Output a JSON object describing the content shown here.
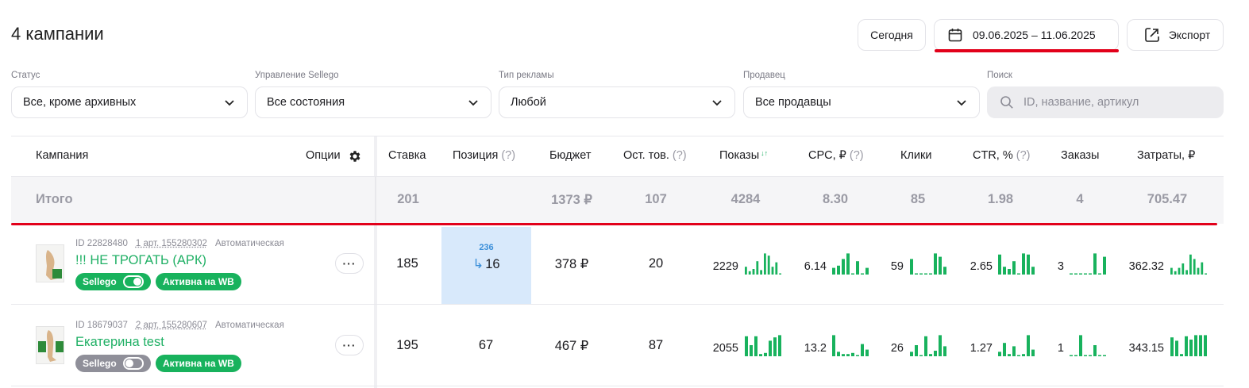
{
  "header": {
    "title": "4 кампании",
    "today_label": "Сегодня",
    "date_range": "09.06.2025 – 11.06.2025",
    "export_label": "Экспорт"
  },
  "filters": {
    "status": {
      "label": "Статус",
      "value": "Все, кроме архивных"
    },
    "management": {
      "label": "Управление Sellego",
      "value": "Все состояния"
    },
    "ad_type": {
      "label": "Тип рекламы",
      "value": "Любой"
    },
    "seller": {
      "label": "Продавец",
      "value": "Все продавцы"
    },
    "search": {
      "label": "Поиск",
      "placeholder": "ID, название, артикул"
    }
  },
  "table": {
    "headers": {
      "campaign": "Кампания",
      "options": "Опции",
      "bid": "Ставка",
      "position": "Позиция",
      "budget": "Бюджет",
      "stock": "Ост. тов.",
      "impressions": "Показы",
      "cpc": "CPC, ₽",
      "clicks": "Клики",
      "ctr": "CTR, %",
      "orders": "Заказы",
      "spend": "Затраты, ₽",
      "help": "(?)"
    },
    "total": {
      "label": "Итого",
      "bid": "201",
      "budget": "1373 ₽",
      "stock": "107",
      "impressions": "4284",
      "cpc": "8.30",
      "clicks": "85",
      "ctr": "1.98",
      "orders": "4",
      "spend": "705.47"
    },
    "rows": [
      {
        "id": "ID 22828480",
        "art": "1 арт. 155280302",
        "type": "Автоматическая",
        "name": "!!! НЕ ТРОГАТЬ (АРК)",
        "sellego": "Sellego",
        "sellego_on": true,
        "status": "Активна на WB",
        "bid": "185",
        "pos_prev": "236",
        "pos_cur": "16",
        "budget": "378 ₽",
        "stock": "20",
        "impressions": "2229",
        "cpc": "6.14",
        "clicks": "59",
        "ctr": "2.65",
        "orders": "3",
        "spend": "362.32",
        "spark": {
          "impressions": [
            0.35,
            0.15,
            0.25,
            0.6,
            0.2,
            0.95,
            0.85,
            0.35,
            0.55,
            0.05
          ],
          "cpc": [
            0.3,
            0.4,
            0.7,
            0.95,
            0.05,
            0.6,
            0.05,
            0.3
          ],
          "clicks": [
            0.7,
            0.05,
            0.05,
            0.05,
            0.05,
            0.95,
            0.8,
            0.35
          ],
          "ctr": [
            0.9,
            0.35,
            0.25,
            0.6,
            0.05,
            0.95,
            0.9,
            0.35
          ],
          "orders": [
            0.05,
            0.05,
            0.05,
            0.05,
            0.05,
            0.95,
            0.05,
            0.8
          ],
          "spend": [
            0.3,
            0.15,
            0.3,
            0.5,
            0.2,
            0.9,
            0.7,
            0.3,
            0.55,
            0.05
          ]
        }
      },
      {
        "id": "ID 18679037",
        "art": "2 арт. 155280607",
        "type": "Автоматическая",
        "name": "Екатерина test",
        "sellego": "Sellego",
        "sellego_on": false,
        "status": "Активна на WB",
        "bid": "195",
        "pos_prev": "",
        "pos_cur": "67",
        "budget": "467 ₽",
        "stock": "87",
        "impressions": "2055",
        "cpc": "13.2",
        "clicks": "26",
        "ctr": "1.27",
        "orders": "1",
        "spend": "343.15",
        "spark": {
          "impressions": [
            0.9,
            0.5,
            0.9,
            0.1,
            0.15,
            0.7,
            0.85,
            0.95
          ],
          "cpc": [
            0.95,
            0.2,
            0.1,
            0.1,
            0.15,
            0.05,
            0.55,
            0.3
          ],
          "clicks": [
            0.2,
            0.5,
            0.05,
            0.9,
            0.1,
            0.25,
            0.95,
            0.45
          ],
          "ctr": [
            0.2,
            0.6,
            0.1,
            0.45,
            0.05,
            0.1,
            0.95,
            0.3
          ],
          "orders": [
            0.05,
            0.05,
            0.95,
            0.05,
            0.05,
            0.5,
            0.05,
            0.05
          ],
          "spend": [
            0.85,
            0.7,
            0.1,
            0.9,
            0.75,
            0.95,
            0.95,
            0.95
          ]
        }
      }
    ]
  },
  "colors": {
    "accent": "#18b25d",
    "highlight": "#d8e9fb",
    "red": "#e2001a"
  },
  "icons": [
    "calendar-icon",
    "export-icon",
    "chevron-down-icon",
    "search-icon",
    "gear-icon",
    "sort-icon",
    "more-icon"
  ]
}
